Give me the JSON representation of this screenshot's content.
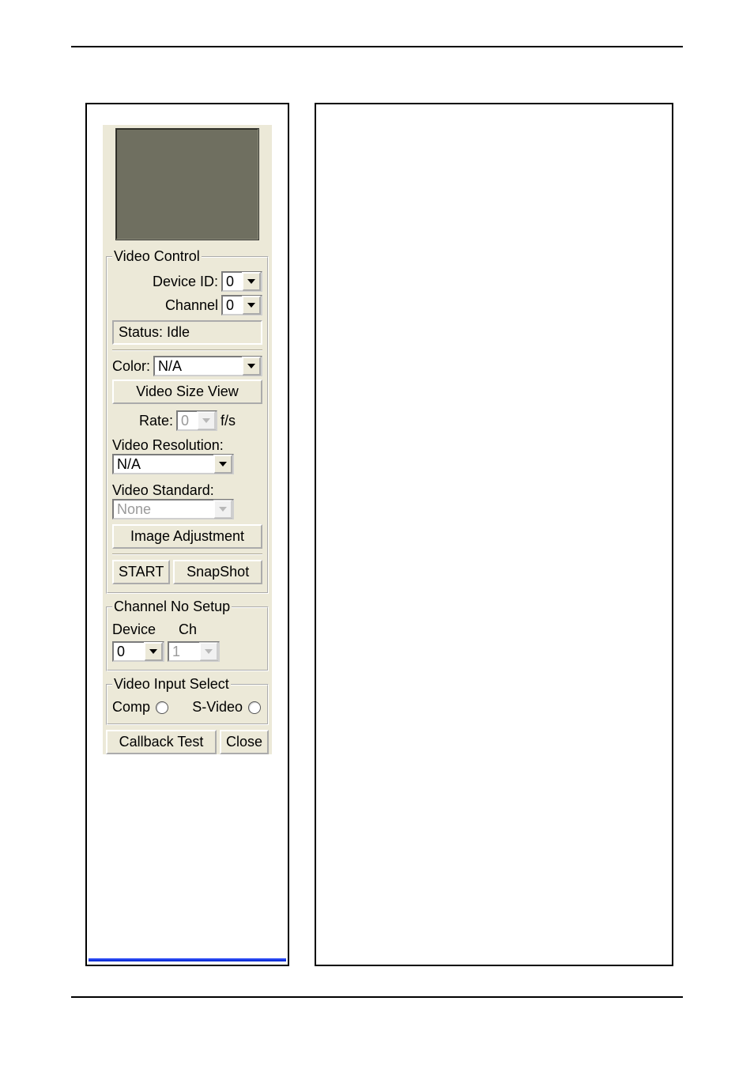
{
  "videoControl": {
    "legend": "Video Control",
    "deviceIdLabel": "Device ID:",
    "deviceIdValue": "0",
    "channelLabel": "Channel",
    "channelValue": "0",
    "statusText": "Status: Idle",
    "colorLabel": "Color:",
    "colorValue": "N/A",
    "videoSizeViewBtn": "Video Size View",
    "rateLabel": "Rate:",
    "rateValue": "0",
    "rateUnit": "f/s",
    "videoResolutionLabel": "Video Resolution:",
    "videoResolutionValue": "N/A",
    "videoStandardLabel": "Video Standard:",
    "videoStandardValue": "None",
    "imageAdjustmentBtn": "Image Adjustment",
    "startBtn": "START",
    "snapshotBtn": "SnapShot"
  },
  "channelNoSetup": {
    "legend": "Channel No Setup",
    "deviceHeader": "Device",
    "chHeader": "Ch",
    "deviceValue": "0",
    "chValue": "1"
  },
  "videoInputSelect": {
    "legend": "Video Input Select",
    "compLabel": "Comp",
    "svideoLabel": "S-Video"
  },
  "footerButtons": {
    "callbackTest": "Callback Test",
    "close": "Close"
  }
}
